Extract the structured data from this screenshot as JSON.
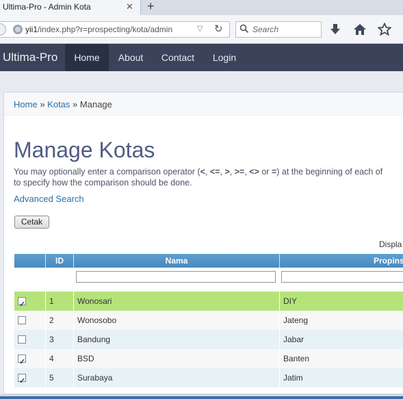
{
  "browser": {
    "tab_title": "Ultima-Pro - Admin Kota",
    "tab_close": "✕",
    "new_tab": "+",
    "url_host": "yii1",
    "url_path": "/index.php?r=prospecting/kota/admin",
    "search_placeholder": "Search"
  },
  "header": {
    "brand": "Ultima-Pro",
    "nav": [
      "Home",
      "About",
      "Contact",
      "Login"
    ],
    "active_nav": "Home"
  },
  "breadcrumb": {
    "items": [
      "Home",
      "Kotas",
      "Manage"
    ],
    "separator": "»"
  },
  "page": {
    "title": "Manage Kotas",
    "help_line1_pre": "You may optionally enter a comparison operator (",
    "help_ops": [
      "<",
      "<=",
      ">",
      ">=",
      "<>",
      "="
    ],
    "help_line1_post": ") at the beginning of each of",
    "help_line2": "to specify how the comparison should be done.",
    "advanced_search": "Advanced Search",
    "cetak": "Cetak",
    "summary": "Displa"
  },
  "grid": {
    "columns": [
      "",
      "ID",
      "Nama",
      "Propinsi"
    ],
    "rows": [
      {
        "checked": true,
        "id": "1",
        "nama": "Wonosari",
        "propinsi": "DIY",
        "selected": true
      },
      {
        "checked": false,
        "id": "2",
        "nama": "Wonosobo",
        "propinsi": "Jateng",
        "selected": false
      },
      {
        "checked": false,
        "id": "3",
        "nama": "Bandung",
        "propinsi": "Jabar",
        "selected": false
      },
      {
        "checked": true,
        "id": "4",
        "nama": "BSD",
        "propinsi": "Banten",
        "selected": false
      },
      {
        "checked": true,
        "id": "5",
        "nama": "Surabaya",
        "propinsi": "Jatim",
        "selected": false
      }
    ]
  },
  "colors": {
    "header_bg": "#3b4259",
    "grid_head": "#4a89bd",
    "selected_row": "#b5e37a",
    "title": "#4f5d84",
    "link": "#2a6fa8"
  }
}
